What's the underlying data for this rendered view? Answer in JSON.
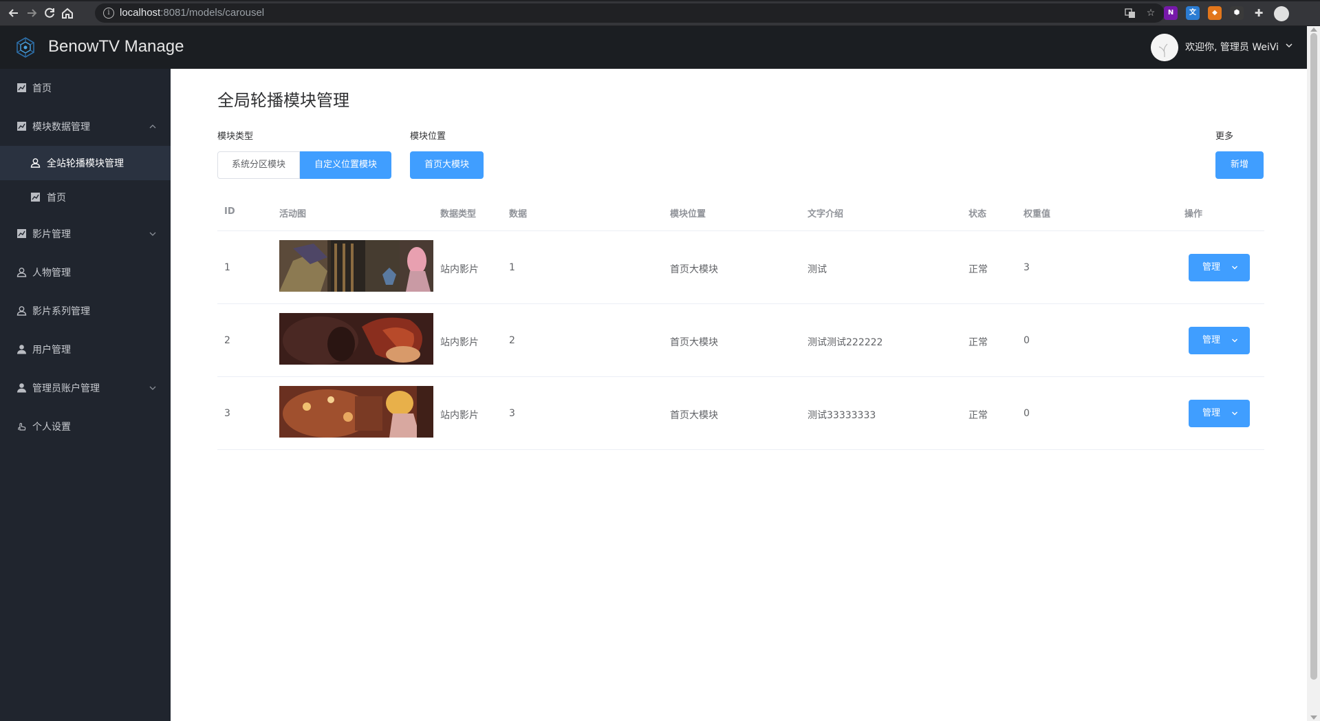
{
  "browser": {
    "url_host": "localhost",
    "url_rest": ":8081/models/carousel"
  },
  "header": {
    "app_title": "BenowTV Manage",
    "greeting": "欢迎你, 管理员 WeiVi"
  },
  "sidebar": {
    "items": [
      {
        "label": "首页"
      },
      {
        "label": "模块数据管理"
      },
      {
        "label": "全站轮播模块管理"
      },
      {
        "label": "首页"
      },
      {
        "label": "影片管理"
      },
      {
        "label": "人物管理"
      },
      {
        "label": "影片系列管理"
      },
      {
        "label": "用户管理"
      },
      {
        "label": "管理员账户管理"
      },
      {
        "label": "个人设置"
      }
    ]
  },
  "main": {
    "title": "全局轮播模块管理",
    "filters": {
      "type_label": "模块类型",
      "type_options": [
        "系统分区模块",
        "自定义位置模块"
      ],
      "type_selected": "自定义位置模块",
      "position_label": "模块位置",
      "position_value": "首页大模块",
      "more_label": "更多",
      "add_label": "新增"
    },
    "table": {
      "headers": [
        "ID",
        "活动图",
        "数据类型",
        "数据",
        "模块位置",
        "文字介绍",
        "状态",
        "权重值",
        "操作"
      ],
      "rows": [
        {
          "id": "1",
          "data_type": "站内影片",
          "data": "1",
          "position": "首页大模块",
          "intro": "测试",
          "status": "正常",
          "weight": "3",
          "action": "管理"
        },
        {
          "id": "2",
          "data_type": "站内影片",
          "data": "2",
          "position": "首页大模块",
          "intro": "测试测试222222",
          "status": "正常",
          "weight": "0",
          "action": "管理"
        },
        {
          "id": "3",
          "data_type": "站内影片",
          "data": "3",
          "position": "首页大模块",
          "intro": "测试33333333",
          "status": "正常",
          "weight": "0",
          "action": "管理"
        }
      ]
    }
  },
  "colors": {
    "primary": "#409eff",
    "sidebar_bg": "#20252e",
    "header_bg": "#1b1e22"
  }
}
